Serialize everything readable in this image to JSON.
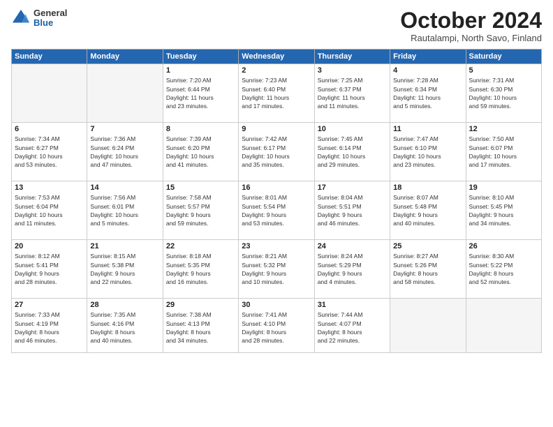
{
  "logo": {
    "general": "General",
    "blue": "Blue"
  },
  "title": "October 2024",
  "subtitle": "Rautalampi, North Savo, Finland",
  "days_header": [
    "Sunday",
    "Monday",
    "Tuesday",
    "Wednesday",
    "Thursday",
    "Friday",
    "Saturday"
  ],
  "weeks": [
    [
      {
        "num": "",
        "info": ""
      },
      {
        "num": "",
        "info": ""
      },
      {
        "num": "1",
        "info": "Sunrise: 7:20 AM\nSunset: 6:44 PM\nDaylight: 11 hours\nand 23 minutes."
      },
      {
        "num": "2",
        "info": "Sunrise: 7:23 AM\nSunset: 6:40 PM\nDaylight: 11 hours\nand 17 minutes."
      },
      {
        "num": "3",
        "info": "Sunrise: 7:25 AM\nSunset: 6:37 PM\nDaylight: 11 hours\nand 11 minutes."
      },
      {
        "num": "4",
        "info": "Sunrise: 7:28 AM\nSunset: 6:34 PM\nDaylight: 11 hours\nand 5 minutes."
      },
      {
        "num": "5",
        "info": "Sunrise: 7:31 AM\nSunset: 6:30 PM\nDaylight: 10 hours\nand 59 minutes."
      }
    ],
    [
      {
        "num": "6",
        "info": "Sunrise: 7:34 AM\nSunset: 6:27 PM\nDaylight: 10 hours\nand 53 minutes."
      },
      {
        "num": "7",
        "info": "Sunrise: 7:36 AM\nSunset: 6:24 PM\nDaylight: 10 hours\nand 47 minutes."
      },
      {
        "num": "8",
        "info": "Sunrise: 7:39 AM\nSunset: 6:20 PM\nDaylight: 10 hours\nand 41 minutes."
      },
      {
        "num": "9",
        "info": "Sunrise: 7:42 AM\nSunset: 6:17 PM\nDaylight: 10 hours\nand 35 minutes."
      },
      {
        "num": "10",
        "info": "Sunrise: 7:45 AM\nSunset: 6:14 PM\nDaylight: 10 hours\nand 29 minutes."
      },
      {
        "num": "11",
        "info": "Sunrise: 7:47 AM\nSunset: 6:10 PM\nDaylight: 10 hours\nand 23 minutes."
      },
      {
        "num": "12",
        "info": "Sunrise: 7:50 AM\nSunset: 6:07 PM\nDaylight: 10 hours\nand 17 minutes."
      }
    ],
    [
      {
        "num": "13",
        "info": "Sunrise: 7:53 AM\nSunset: 6:04 PM\nDaylight: 10 hours\nand 11 minutes."
      },
      {
        "num": "14",
        "info": "Sunrise: 7:56 AM\nSunset: 6:01 PM\nDaylight: 10 hours\nand 5 minutes."
      },
      {
        "num": "15",
        "info": "Sunrise: 7:58 AM\nSunset: 5:57 PM\nDaylight: 9 hours\nand 59 minutes."
      },
      {
        "num": "16",
        "info": "Sunrise: 8:01 AM\nSunset: 5:54 PM\nDaylight: 9 hours\nand 53 minutes."
      },
      {
        "num": "17",
        "info": "Sunrise: 8:04 AM\nSunset: 5:51 PM\nDaylight: 9 hours\nand 46 minutes."
      },
      {
        "num": "18",
        "info": "Sunrise: 8:07 AM\nSunset: 5:48 PM\nDaylight: 9 hours\nand 40 minutes."
      },
      {
        "num": "19",
        "info": "Sunrise: 8:10 AM\nSunset: 5:45 PM\nDaylight: 9 hours\nand 34 minutes."
      }
    ],
    [
      {
        "num": "20",
        "info": "Sunrise: 8:12 AM\nSunset: 5:41 PM\nDaylight: 9 hours\nand 28 minutes."
      },
      {
        "num": "21",
        "info": "Sunrise: 8:15 AM\nSunset: 5:38 PM\nDaylight: 9 hours\nand 22 minutes."
      },
      {
        "num": "22",
        "info": "Sunrise: 8:18 AM\nSunset: 5:35 PM\nDaylight: 9 hours\nand 16 minutes."
      },
      {
        "num": "23",
        "info": "Sunrise: 8:21 AM\nSunset: 5:32 PM\nDaylight: 9 hours\nand 10 minutes."
      },
      {
        "num": "24",
        "info": "Sunrise: 8:24 AM\nSunset: 5:29 PM\nDaylight: 9 hours\nand 4 minutes."
      },
      {
        "num": "25",
        "info": "Sunrise: 8:27 AM\nSunset: 5:26 PM\nDaylight: 8 hours\nand 58 minutes."
      },
      {
        "num": "26",
        "info": "Sunrise: 8:30 AM\nSunset: 5:22 PM\nDaylight: 8 hours\nand 52 minutes."
      }
    ],
    [
      {
        "num": "27",
        "info": "Sunrise: 7:33 AM\nSunset: 4:19 PM\nDaylight: 8 hours\nand 46 minutes."
      },
      {
        "num": "28",
        "info": "Sunrise: 7:35 AM\nSunset: 4:16 PM\nDaylight: 8 hours\nand 40 minutes."
      },
      {
        "num": "29",
        "info": "Sunrise: 7:38 AM\nSunset: 4:13 PM\nDaylight: 8 hours\nand 34 minutes."
      },
      {
        "num": "30",
        "info": "Sunrise: 7:41 AM\nSunset: 4:10 PM\nDaylight: 8 hours\nand 28 minutes."
      },
      {
        "num": "31",
        "info": "Sunrise: 7:44 AM\nSunset: 4:07 PM\nDaylight: 8 hours\nand 22 minutes."
      },
      {
        "num": "",
        "info": ""
      },
      {
        "num": "",
        "info": ""
      }
    ]
  ]
}
